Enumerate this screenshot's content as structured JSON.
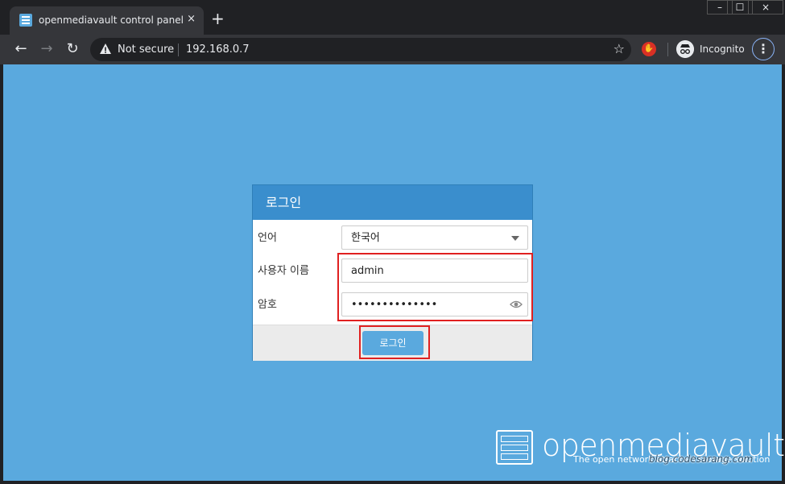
{
  "browser": {
    "tab_title": "openmediavault control panel - openmediavault",
    "tab_close": "×",
    "new_tab": "+",
    "window_controls": [
      "–",
      "☐",
      "×"
    ],
    "security_label": "Not secure",
    "url": "192.168.0.7",
    "profile_label": "Incognito"
  },
  "login": {
    "title": "로그인",
    "language_label": "언어",
    "language_value": "한국어",
    "username_label": "사용자 이름",
    "username_value": "admin",
    "password_label": "암호",
    "password_value": "••••••••••••••",
    "login_button": "로그인"
  },
  "branding": {
    "name": "openmediavault",
    "tagline": "The open network attached storage solution",
    "watermark": "blog.codesarang.com"
  },
  "colors": {
    "page_background": "#5aa9de",
    "dialog_header": "#3a8ecd",
    "highlight": "#e02020"
  }
}
